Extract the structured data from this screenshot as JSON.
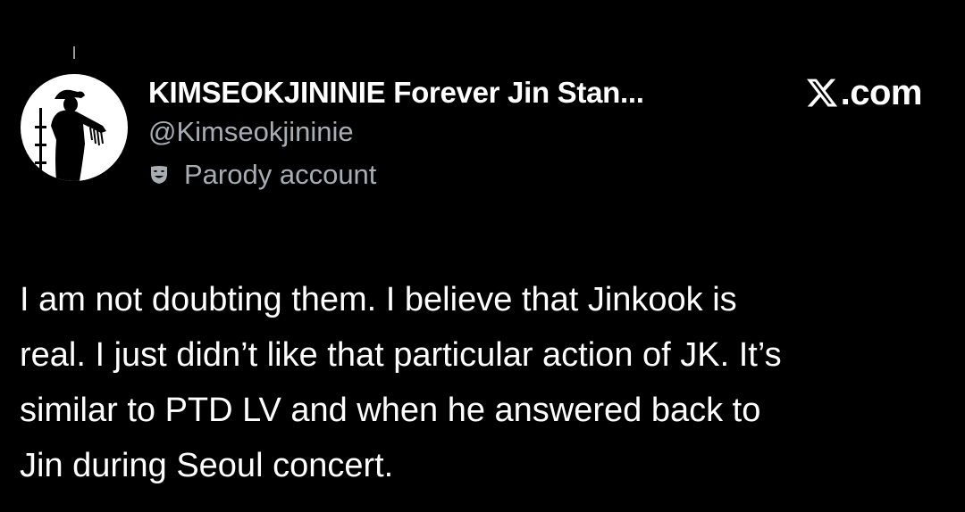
{
  "tweet": {
    "author": {
      "display_name": "KIMSEOKJININIE Forever Jin Stan...",
      "handle": "@Kimseokjininie",
      "label_icon": "drama-mask-icon",
      "label": "Parody account"
    },
    "brand": {
      "text": ".com",
      "icon": "x-logo-icon"
    },
    "text_lines": [
      "I am not doubting them. I believe that Jinkook is",
      "real. I just didn’t like that particular action of JK. It’s",
      "similar to PTD LV and when he answered back to",
      "Jin during Seoul concert."
    ]
  },
  "colors": {
    "background": "#000000",
    "primary_text": "#ffffff",
    "secondary_text": "#a8adb3",
    "avatar_background": "#ffffff"
  }
}
